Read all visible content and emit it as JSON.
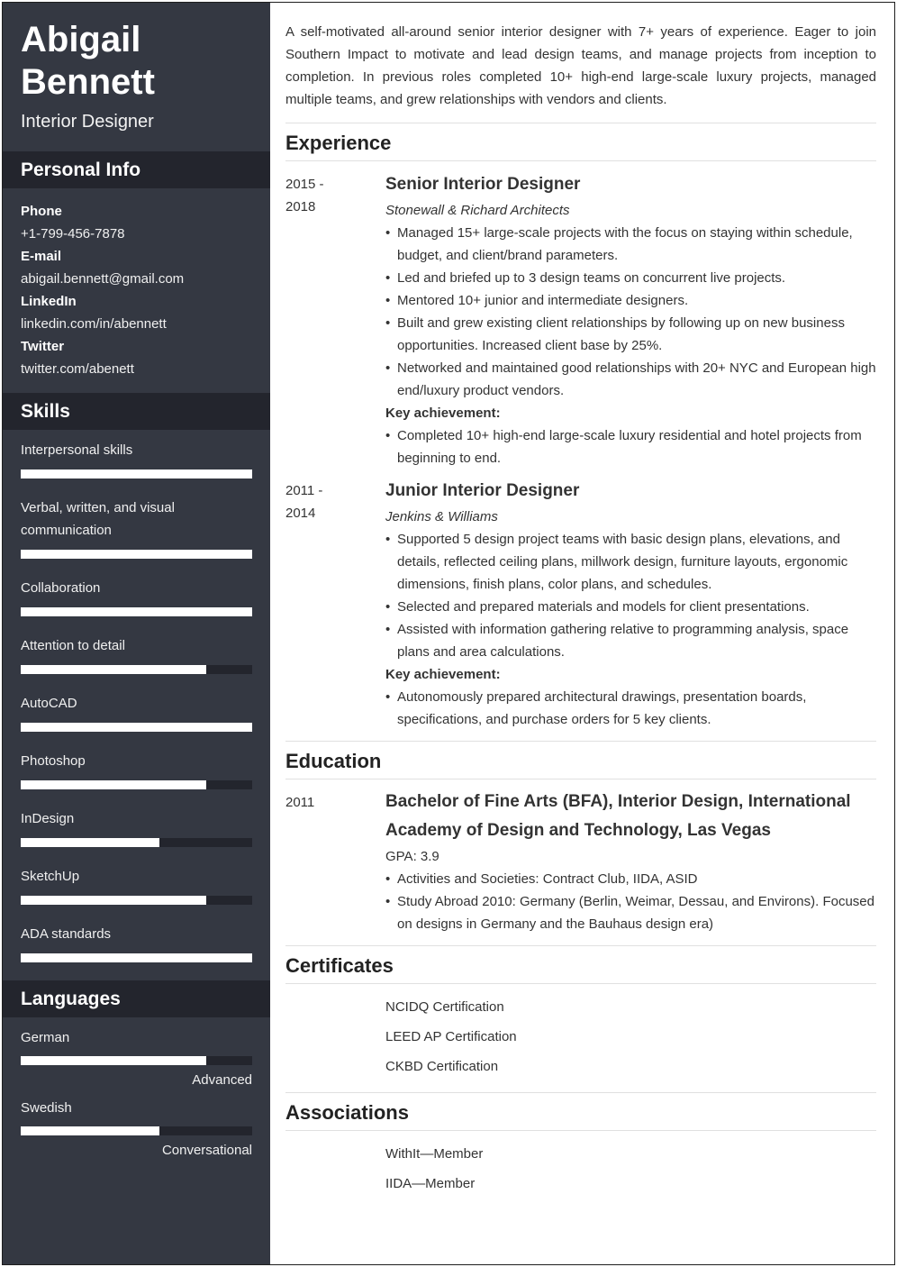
{
  "sidebar": {
    "name_first": "Abigail",
    "name_last": "Bennett",
    "job_title": "Interior Designer",
    "personal_info": {
      "heading": "Personal Info",
      "items": [
        {
          "label": "Phone",
          "value": "+1-799-456-7878"
        },
        {
          "label": "E-mail",
          "value": "abigail.bennett@gmail.com"
        },
        {
          "label": "LinkedIn",
          "value": "linkedin.com/in/abennett"
        },
        {
          "label": "Twitter",
          "value": "twitter.com/abenett"
        }
      ]
    },
    "skills": {
      "heading": "Skills",
      "items": [
        {
          "name": "Interpersonal skills",
          "level": 1.0
        },
        {
          "name": "Verbal, written, and visual communication",
          "level": 1.0
        },
        {
          "name": "Collaboration",
          "level": 1.0
        },
        {
          "name": "Attention to detail",
          "level": 0.8
        },
        {
          "name": "AutoCAD",
          "level": 1.0
        },
        {
          "name": "Photoshop",
          "level": 0.8
        },
        {
          "name": "InDesign",
          "level": 0.6
        },
        {
          "name": "SketchUp",
          "level": 0.8
        },
        {
          "name": "ADA standards",
          "level": 1.0
        }
      ]
    },
    "languages": {
      "heading": "Languages",
      "items": [
        {
          "name": "German",
          "level": 0.8,
          "level_label": "Advanced"
        },
        {
          "name": "Swedish",
          "level": 0.6,
          "level_label": "Conversational"
        }
      ]
    }
  },
  "main": {
    "summary": "A self-motivated all-around senior interior designer with 7+ years of experience. Eager to join Southern Impact to motivate and lead design teams, and manage projects from inception to completion. In previous roles completed 10+ high-end large-scale luxury projects, managed multiple teams, and grew relationships with vendors and clients.",
    "experience": {
      "heading": "Experience",
      "entries": [
        {
          "date_start": "2015 -",
          "date_end": "2018",
          "title": "Senior Interior Designer",
          "company": "Stonewall & Richard Architects",
          "bullets": [
            "Managed 15+ large-scale projects with the focus on staying within schedule, budget, and client/brand parameters.",
            "Led and briefed up to 3 design teams on concurrent live projects.",
            "Mentored 10+ junior and intermediate designers.",
            "Built and grew existing client relationships by following up on new business opportunities. Increased client base by 25%.",
            "Networked and maintained good relationships with 20+ NYC and European high end/luxury product vendors."
          ],
          "key_label": "Key achievement:",
          "key_bullets": [
            "Completed 10+ high-end large-scale luxury residential and hotel projects from beginning to end."
          ]
        },
        {
          "date_start": "2011 -",
          "date_end": "2014",
          "title": "Junior Interior Designer",
          "company": "Jenkins & Williams",
          "bullets": [
            "Supported 5 design project teams with basic design plans, elevations, and details, reflected ceiling plans, millwork design, furniture layouts, ergonomic dimensions, finish plans, color plans, and schedules.",
            "Selected and prepared materials and models for client presentations.",
            "Assisted with information gathering relative to programming analysis, space plans and area calculations."
          ],
          "key_label": "Key achievement:",
          "key_bullets": [
            "Autonomously prepared architectural drawings, presentation boards, specifications, and purchase orders for 5 key clients."
          ]
        }
      ]
    },
    "education": {
      "heading": "Education",
      "date": "2011",
      "title": "Bachelor of Fine Arts (BFA), Interior Design, International Academy of Design and Technology, Las Vegas",
      "gpa": "GPA: 3.9",
      "bullets": [
        "Activities and Societies: Contract Club, IIDA, ASID",
        "Study Abroad 2010: Germany (Berlin, Weimar, Dessau, and Environs). Focused on designs in Germany and the Bauhaus design era)"
      ]
    },
    "certificates": {
      "heading": "Certificates",
      "items": [
        "NCIDQ Certification",
        "LEED AP Certification",
        "CKBD Certification"
      ]
    },
    "associations": {
      "heading": "Associations",
      "items": [
        "WithIt—Member",
        "IIDA—Member"
      ]
    }
  }
}
